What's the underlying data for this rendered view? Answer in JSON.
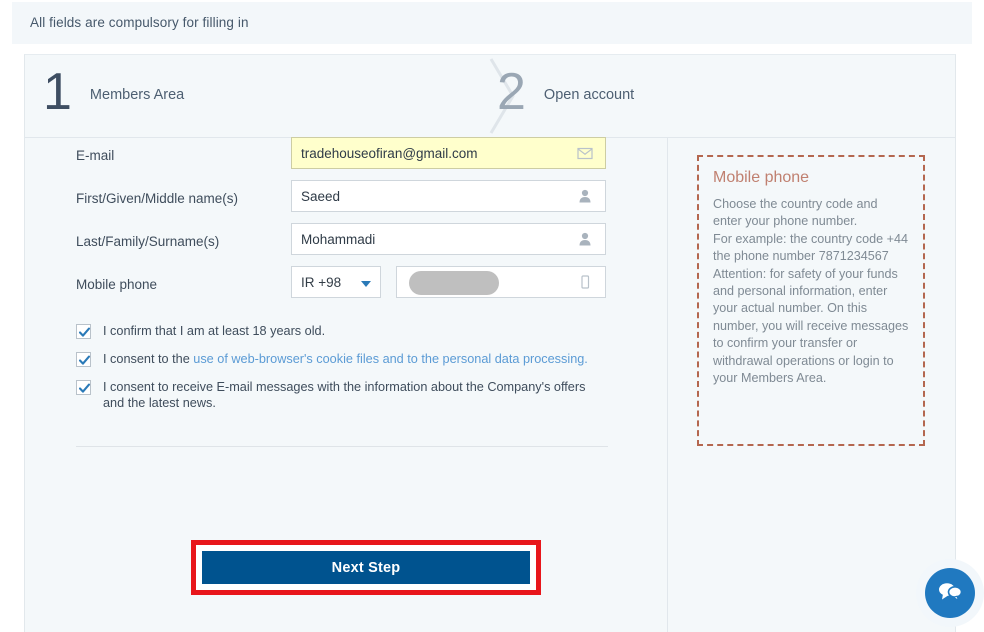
{
  "notice": {
    "text": "All fields are compulsory for filling in"
  },
  "steps": [
    {
      "number": "1",
      "label": "Members Area"
    },
    {
      "number": "2",
      "label": "Open account"
    }
  ],
  "form": {
    "fields": [
      {
        "label": "E-mail",
        "value": "tradehouseofiran@gmail.com",
        "placeholder": "",
        "icon": "envelope-icon",
        "autofill": true
      },
      {
        "label": "First/Given/Middle name(s)",
        "value": "Saeed",
        "placeholder": "",
        "icon": "user-icon",
        "autofill": false
      },
      {
        "label": "Last/Family/Surname(s)",
        "value": "Mohammadi",
        "placeholder": "",
        "icon": "user-icon",
        "autofill": false
      }
    ],
    "phone": {
      "label": "Mobile phone",
      "country_code": "IR +98",
      "value": "",
      "placeholder": "",
      "icon": "mobile-icon",
      "redacted": true
    }
  },
  "consents": [
    {
      "checked": true,
      "text": "I confirm that I am at least 18 years old.",
      "prefix": "",
      "link": "",
      "suffix": ""
    },
    {
      "checked": true,
      "text": "I consent to the use of web-browser's cookie files and to the personal data processing.",
      "prefix": "I consent to the ",
      "link": "use of web-browser's cookie files and to the personal data processing.",
      "suffix": ""
    },
    {
      "checked": true,
      "text": "I consent to receive E-mail messages with the information about the Company's offers and the latest news.",
      "prefix": "",
      "link": "",
      "suffix": ""
    }
  ],
  "next_button": {
    "label": "Next Step"
  },
  "info_box": {
    "title": "Mobile phone",
    "body": "Choose the country code and enter your phone number.\nFor example: the country code +44 the phone number 7871234567\nAttention: for safety of your funds and personal information, enter your actual number. On this number, you will receive messages to confirm your transfer or withdrawal operations or login to your Members Area."
  },
  "chat": {
    "icon": "chat-bubbles-icon",
    "label": ""
  },
  "colors": {
    "panel_bg": "#f4f8fa",
    "notice_bg": "#f3f7fa",
    "accent_blue": "#00538f",
    "highlight_red": "#e8161b",
    "link_blue": "#5b9bd5",
    "info_border": "#b4674f",
    "info_title": "#c08070",
    "autofill_yellow": "#ffffcc",
    "chat_blue": "#2079c0"
  }
}
